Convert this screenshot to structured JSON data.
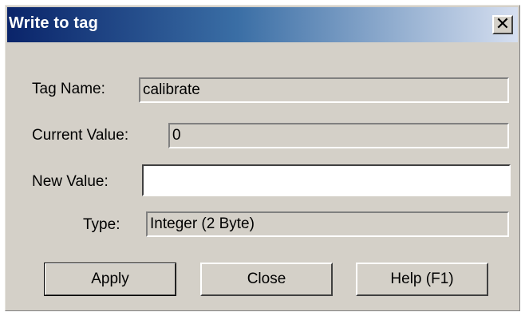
{
  "window": {
    "title": "Write to tag",
    "close_glyph": "✕"
  },
  "fields": {
    "tag_name": {
      "label": "Tag Name:",
      "value": "calibrate"
    },
    "current_value": {
      "label": "Current Value:",
      "value": "0"
    },
    "new_value": {
      "label": "New Value:",
      "value": ""
    },
    "type": {
      "label": "Type:",
      "value": "Integer (2 Byte)"
    }
  },
  "buttons": {
    "apply": "Apply",
    "close": "Close",
    "help": "Help (F1)"
  }
}
